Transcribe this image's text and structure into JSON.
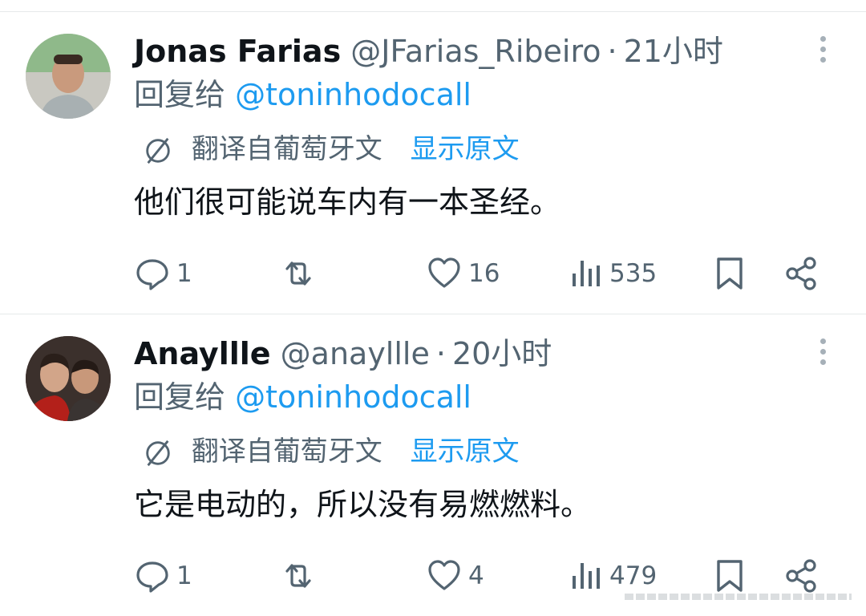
{
  "tweets": [
    {
      "author_name": "Jonas Farias",
      "handle": "@JFarias_Ribeiro",
      "separator": "·",
      "time": "21小时",
      "reply_prefix": "回复给",
      "reply_to": "@toninhodocall",
      "translated_label": "翻译自葡萄牙文",
      "show_original": "显示原文",
      "body": "他们很可能说车内有一本圣经。",
      "replies": "1",
      "likes": "16",
      "views": "535"
    },
    {
      "author_name": "Anayllle",
      "handle": "@anayllle",
      "separator": "·",
      "time": "20小时",
      "reply_prefix": "回复给",
      "reply_to": "@toninhodocall",
      "translated_label": "翻译自葡萄牙文",
      "show_original": "显示原文",
      "body": "它是电动的，所以没有易燃燃料。",
      "replies": "1",
      "likes": "4",
      "views": "479"
    }
  ],
  "icons": {
    "more": "more-vertical-icon",
    "reply": "comment-bubble-icon",
    "retweet": "retweet-icon",
    "like": "heart-icon",
    "views": "bar-chart-icon",
    "bookmark": "bookmark-icon",
    "share": "share-icon",
    "translate": "translate-globe-icon"
  },
  "colors": {
    "primary_text": "#0f1419",
    "secondary_text": "#536471",
    "link": "#1d9bf0",
    "divider": "#e6e9ea"
  }
}
